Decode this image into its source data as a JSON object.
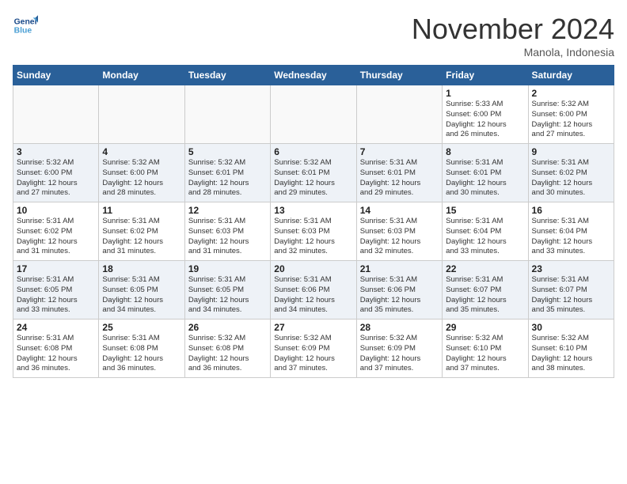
{
  "header": {
    "logo_line1": "General",
    "logo_line2": "Blue",
    "month_title": "November 2024",
    "location": "Manola, Indonesia"
  },
  "days_of_week": [
    "Sunday",
    "Monday",
    "Tuesday",
    "Wednesday",
    "Thursday",
    "Friday",
    "Saturday"
  ],
  "weeks": [
    [
      {
        "date": "",
        "info": ""
      },
      {
        "date": "",
        "info": ""
      },
      {
        "date": "",
        "info": ""
      },
      {
        "date": "",
        "info": ""
      },
      {
        "date": "",
        "info": ""
      },
      {
        "date": "1",
        "info": "Sunrise: 5:33 AM\nSunset: 6:00 PM\nDaylight: 12 hours\nand 26 minutes."
      },
      {
        "date": "2",
        "info": "Sunrise: 5:32 AM\nSunset: 6:00 PM\nDaylight: 12 hours\nand 27 minutes."
      }
    ],
    [
      {
        "date": "3",
        "info": "Sunrise: 5:32 AM\nSunset: 6:00 PM\nDaylight: 12 hours\nand 27 minutes."
      },
      {
        "date": "4",
        "info": "Sunrise: 5:32 AM\nSunset: 6:00 PM\nDaylight: 12 hours\nand 28 minutes."
      },
      {
        "date": "5",
        "info": "Sunrise: 5:32 AM\nSunset: 6:01 PM\nDaylight: 12 hours\nand 28 minutes."
      },
      {
        "date": "6",
        "info": "Sunrise: 5:32 AM\nSunset: 6:01 PM\nDaylight: 12 hours\nand 29 minutes."
      },
      {
        "date": "7",
        "info": "Sunrise: 5:31 AM\nSunset: 6:01 PM\nDaylight: 12 hours\nand 29 minutes."
      },
      {
        "date": "8",
        "info": "Sunrise: 5:31 AM\nSunset: 6:01 PM\nDaylight: 12 hours\nand 30 minutes."
      },
      {
        "date": "9",
        "info": "Sunrise: 5:31 AM\nSunset: 6:02 PM\nDaylight: 12 hours\nand 30 minutes."
      }
    ],
    [
      {
        "date": "10",
        "info": "Sunrise: 5:31 AM\nSunset: 6:02 PM\nDaylight: 12 hours\nand 31 minutes."
      },
      {
        "date": "11",
        "info": "Sunrise: 5:31 AM\nSunset: 6:02 PM\nDaylight: 12 hours\nand 31 minutes."
      },
      {
        "date": "12",
        "info": "Sunrise: 5:31 AM\nSunset: 6:03 PM\nDaylight: 12 hours\nand 31 minutes."
      },
      {
        "date": "13",
        "info": "Sunrise: 5:31 AM\nSunset: 6:03 PM\nDaylight: 12 hours\nand 32 minutes."
      },
      {
        "date": "14",
        "info": "Sunrise: 5:31 AM\nSunset: 6:03 PM\nDaylight: 12 hours\nand 32 minutes."
      },
      {
        "date": "15",
        "info": "Sunrise: 5:31 AM\nSunset: 6:04 PM\nDaylight: 12 hours\nand 33 minutes."
      },
      {
        "date": "16",
        "info": "Sunrise: 5:31 AM\nSunset: 6:04 PM\nDaylight: 12 hours\nand 33 minutes."
      }
    ],
    [
      {
        "date": "17",
        "info": "Sunrise: 5:31 AM\nSunset: 6:05 PM\nDaylight: 12 hours\nand 33 minutes."
      },
      {
        "date": "18",
        "info": "Sunrise: 5:31 AM\nSunset: 6:05 PM\nDaylight: 12 hours\nand 34 minutes."
      },
      {
        "date": "19",
        "info": "Sunrise: 5:31 AM\nSunset: 6:05 PM\nDaylight: 12 hours\nand 34 minutes."
      },
      {
        "date": "20",
        "info": "Sunrise: 5:31 AM\nSunset: 6:06 PM\nDaylight: 12 hours\nand 34 minutes."
      },
      {
        "date": "21",
        "info": "Sunrise: 5:31 AM\nSunset: 6:06 PM\nDaylight: 12 hours\nand 35 minutes."
      },
      {
        "date": "22",
        "info": "Sunrise: 5:31 AM\nSunset: 6:07 PM\nDaylight: 12 hours\nand 35 minutes."
      },
      {
        "date": "23",
        "info": "Sunrise: 5:31 AM\nSunset: 6:07 PM\nDaylight: 12 hours\nand 35 minutes."
      }
    ],
    [
      {
        "date": "24",
        "info": "Sunrise: 5:31 AM\nSunset: 6:08 PM\nDaylight: 12 hours\nand 36 minutes."
      },
      {
        "date": "25",
        "info": "Sunrise: 5:31 AM\nSunset: 6:08 PM\nDaylight: 12 hours\nand 36 minutes."
      },
      {
        "date": "26",
        "info": "Sunrise: 5:32 AM\nSunset: 6:08 PM\nDaylight: 12 hours\nand 36 minutes."
      },
      {
        "date": "27",
        "info": "Sunrise: 5:32 AM\nSunset: 6:09 PM\nDaylight: 12 hours\nand 37 minutes."
      },
      {
        "date": "28",
        "info": "Sunrise: 5:32 AM\nSunset: 6:09 PM\nDaylight: 12 hours\nand 37 minutes."
      },
      {
        "date": "29",
        "info": "Sunrise: 5:32 AM\nSunset: 6:10 PM\nDaylight: 12 hours\nand 37 minutes."
      },
      {
        "date": "30",
        "info": "Sunrise: 5:32 AM\nSunset: 6:10 PM\nDaylight: 12 hours\nand 38 minutes."
      }
    ]
  ]
}
